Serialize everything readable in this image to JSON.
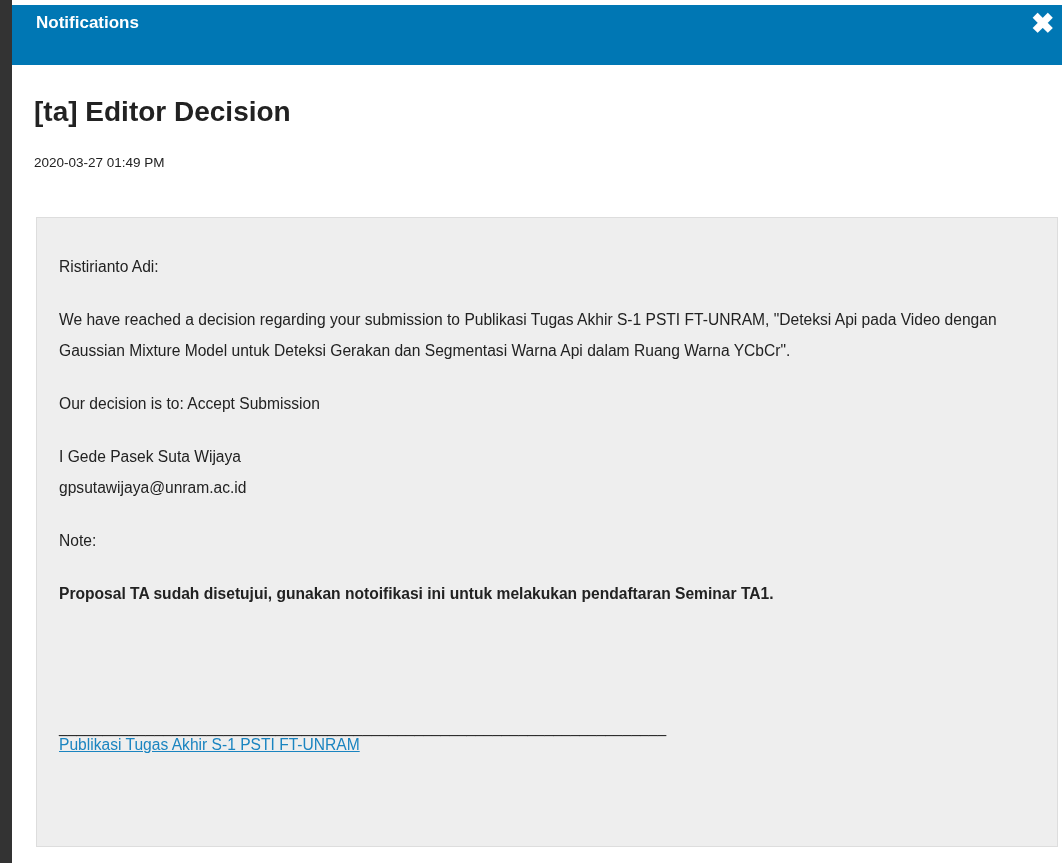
{
  "dialog": {
    "title": "Notifications",
    "close": "✖"
  },
  "notification": {
    "subject": "[ta] Editor Decision",
    "date": "2020-03-27 01:49 PM"
  },
  "message": [
    {
      "kind": "text",
      "lines": [
        "Ristirianto Adi:"
      ]
    },
    {
      "kind": "text",
      "lines": [
        "We have reached a decision regarding your submission to Publikasi Tugas Akhir S-1 PSTI FT-UNRAM, \"Deteksi Api pada Video dengan Gaussian Mixture Model untuk Deteksi Gerakan dan Segmentasi Warna Api dalam Ruang Warna YCbCr\"."
      ]
    },
    {
      "kind": "text",
      "lines": [
        "Our decision is to: Accept Submission"
      ]
    },
    {
      "kind": "text",
      "lines": [
        "I Gede Pasek Suta Wijaya",
        "gpsutawijaya@unram.ac.id"
      ]
    },
    {
      "kind": "text",
      "lines": [
        "Note:"
      ]
    },
    {
      "kind": "bold",
      "lines": [
        "Proposal TA sudah disetujui, gunakan notoifikasi ini untuk melakukan pendaftaran Seminar TA1."
      ]
    },
    {
      "kind": "rule",
      "lines": [
        "______________________________________________________________________"
      ]
    },
    {
      "kind": "link",
      "lines": [
        "Publikasi Tugas Akhir S-1 PSTI FT-UNRAM"
      ]
    }
  ]
}
